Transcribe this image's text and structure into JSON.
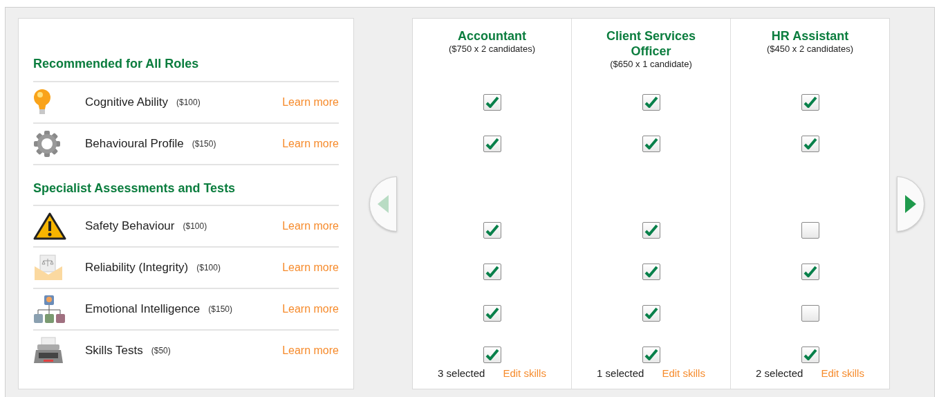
{
  "sections": [
    {
      "title": "Recommended for All Roles",
      "items": [
        {
          "kind": "bulb",
          "name": "Cognitive Ability",
          "price": "($100)",
          "link": "Learn more"
        },
        {
          "kind": "gear",
          "name": "Behavioural Profile",
          "price": "($150)",
          "link": "Learn more"
        }
      ]
    },
    {
      "title": "Specialist Assessments and Tests",
      "items": [
        {
          "kind": "warning",
          "name": "Safety Behaviour",
          "price": "($100)",
          "link": "Learn more"
        },
        {
          "kind": "envelope",
          "name": "Reliability (Integrity)",
          "price": "($100)",
          "link": "Learn more"
        },
        {
          "kind": "org",
          "name": "Emotional Intelligence",
          "price": "($150)",
          "link": "Learn more"
        },
        {
          "kind": "typewriter",
          "name": "Skills Tests",
          "price": "($50)",
          "link": "Learn more"
        }
      ]
    }
  ],
  "prev": {
    "disabled": true
  },
  "next": {
    "disabled": false
  },
  "roles": [
    {
      "title": "Accountant",
      "subtitle": "($750 x 2 candidates)",
      "checks": [
        [
          true,
          true
        ],
        [
          true,
          true,
          true,
          true
        ]
      ],
      "count": "3 selected",
      "edit": "Edit skills"
    },
    {
      "title": "Client Services Officer",
      "subtitle": "($650 x 1 candidate)",
      "checks": [
        [
          true,
          true
        ],
        [
          true,
          true,
          true,
          true
        ]
      ],
      "count": "1 selected",
      "edit": "Edit skills"
    },
    {
      "title": "HR Assistant",
      "subtitle": "($450 x 2 candidates)",
      "checks": [
        [
          true,
          true
        ],
        [
          false,
          true,
          false,
          true
        ]
      ],
      "count": "2 selected",
      "edit": "Edit skills"
    }
  ]
}
